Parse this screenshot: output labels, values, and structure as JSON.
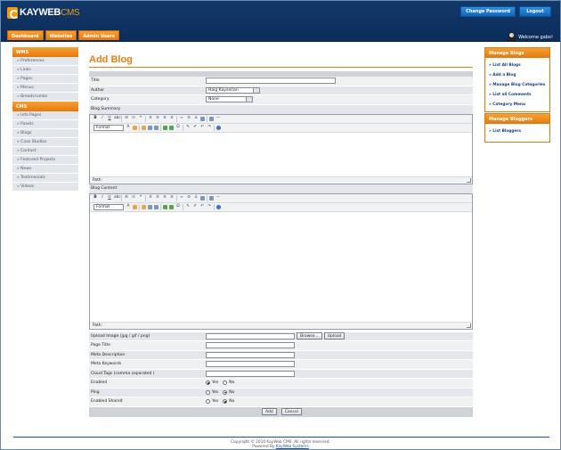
{
  "header": {
    "logo_brand": "KAYWEB",
    "logo_sub": "CMS",
    "change_password": "Change Password",
    "logout": "Logout",
    "welcome": "Welcome gabo!"
  },
  "nav": [
    {
      "label": "Dashboard"
    },
    {
      "label": "Websites"
    },
    {
      "label": "Admin Users"
    }
  ],
  "left_sidebar": {
    "wms_title": "WMS",
    "wms_items": [
      "» Preferences",
      "» Links",
      "» Pages",
      "» Menus",
      "» Breadcrumbs"
    ],
    "cms_title": "CMS",
    "cms_items": [
      "» Info Pages",
      "» Panels",
      "» Blogs",
      "» Case Studies",
      "» Contact",
      "» Featured Projects",
      "» News",
      "» Testimonials",
      "» Videos"
    ]
  },
  "right_sidebar": {
    "blogs_title": "Manage Blogs",
    "blogs_items": [
      "» List All Blogs",
      "» Add a Blog",
      "» Manage Blog Categories",
      "» List all Comments",
      "» Category Menu"
    ],
    "bloggers_title": "Manage Bloggers",
    "bloggers_items": [
      "» List Bloggers"
    ]
  },
  "main": {
    "title": "Add Blog",
    "title_label": "Title",
    "author_label": "Author",
    "author_value": "Haig Kayserian",
    "category_label": "Category",
    "category_value": "None",
    "summary_label": "Blog Summary",
    "content_label": "Blog Content",
    "format_label": "Format",
    "path_label": "Path:",
    "upload_label": "Upload Image  (jpg / gif / png)",
    "browse_label": "Browse...",
    "upload_button": "Upload",
    "page_title_label": "Page Title",
    "meta_description_label": "Meta Description",
    "meta_keywords_label": "Meta Keywords",
    "cloud_tags_label": "Cloud Tags (comma separated )",
    "enabled_label": "Enabled",
    "ping_label": "Ping",
    "sharelt_label": "Enabled Sharelt",
    "yes_label": "Yes",
    "no_label": "No",
    "add_button": "Add",
    "cancel_button": "Cancel"
  },
  "footer": {
    "copyright": "Copyright © 2010 KayWeb CMS. All rights reserved.",
    "powered_by": "Powered By",
    "powered_link": "KayWeb Systems"
  },
  "colors": {
    "header_bg": "#0b2c58",
    "accent_orange": "#e27810",
    "link_blue": "#1a3f7a"
  }
}
